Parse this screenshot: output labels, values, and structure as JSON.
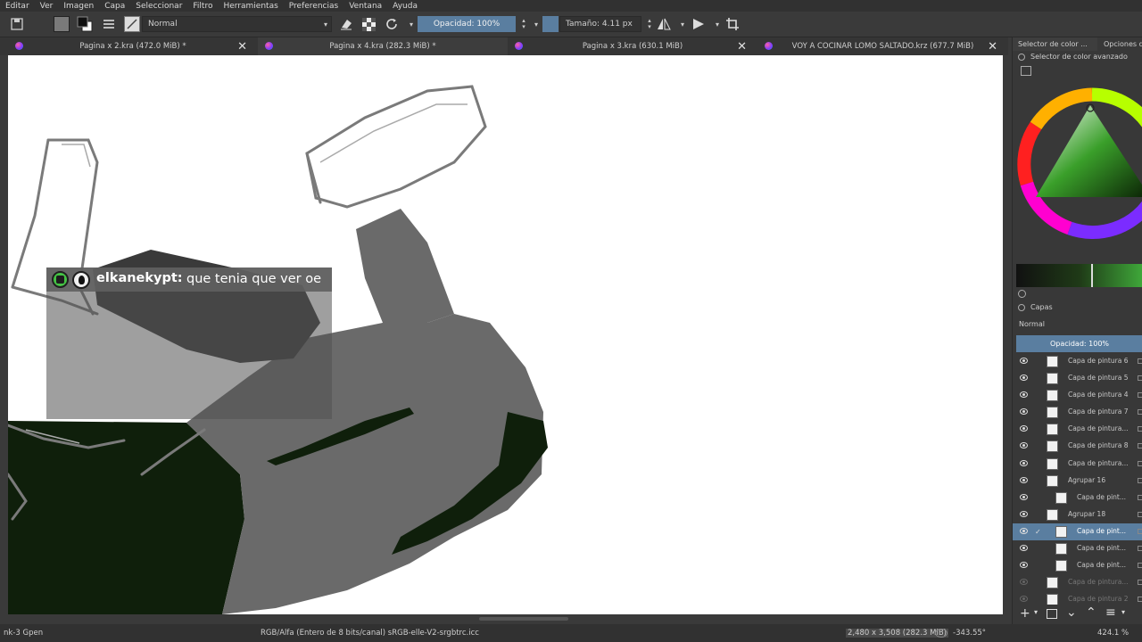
{
  "menu": [
    "Editar",
    "Ver",
    "Imagen",
    "Capa",
    "Seleccionar",
    "Filtro",
    "Herramientas",
    "Preferencias",
    "Ventana",
    "Ayuda"
  ],
  "toolbar": {
    "blend_mode": "Normal",
    "opacity_label": "Opacidad: 100%",
    "size_label": "Tamaño: 4.11 px",
    "icons": [
      "save-icon",
      "color-swatch-icon",
      "swap-colors-icon",
      "brush-presets-icon",
      "brush-preview-icon",
      "eraser-icon",
      "alpha-lock-icon",
      "reload-icon",
      "mirror-horizontal-icon",
      "mirror-vertical-icon",
      "crop-icon"
    ]
  },
  "tabs": [
    {
      "title": "Pagina x 2.kra (472.0 MiB) *"
    },
    {
      "title": "Pagina x 4.kra (282.3 MiB) *"
    },
    {
      "title": "Pagina x 3.kra (630.1 MiB)"
    },
    {
      "title": "VOY A COCINAR LOMO SALTADO.krz (677.7 MiB)"
    }
  ],
  "chat": {
    "username": "elkanekypt:",
    "message": "que tenia que ver oe"
  },
  "docker": {
    "tab_color": "Selector de color ...",
    "tab_options": "Opciones de",
    "color_header": "Selector de color avanzado",
    "layers_header": "Capas",
    "layers_blend": "Normal",
    "layers_opacity": "Opacidad:  100%",
    "layers": [
      {
        "name": "Capa de pintura 6",
        "visible": true,
        "indent": 0,
        "group": false,
        "selected": false,
        "dim": false
      },
      {
        "name": "Capa de pintura 5",
        "visible": true,
        "indent": 0,
        "group": false,
        "selected": false,
        "dim": false
      },
      {
        "name": "Capa de pintura 4",
        "visible": true,
        "indent": 0,
        "group": false,
        "selected": false,
        "dim": false
      },
      {
        "name": "Capa de pintura 7",
        "visible": true,
        "indent": 0,
        "group": false,
        "selected": false,
        "dim": false
      },
      {
        "name": "Capa de pintura...",
        "visible": true,
        "indent": 0,
        "group": false,
        "selected": false,
        "dim": false
      },
      {
        "name": "Capa de pintura 8",
        "visible": true,
        "indent": 0,
        "group": false,
        "selected": false,
        "dim": false
      },
      {
        "name": "Capa de pintura...",
        "visible": true,
        "indent": 0,
        "group": false,
        "selected": false,
        "dim": false
      },
      {
        "name": "Agrupar 16",
        "visible": true,
        "indent": 0,
        "group": true,
        "selected": false,
        "dim": false
      },
      {
        "name": "Capa de pint...",
        "visible": true,
        "indent": 1,
        "group": false,
        "selected": false,
        "dim": false
      },
      {
        "name": "Agrupar 18",
        "visible": true,
        "indent": 0,
        "group": true,
        "selected": false,
        "dim": false
      },
      {
        "name": "Capa de pint...",
        "visible": true,
        "indent": 1,
        "group": false,
        "selected": true,
        "dim": false
      },
      {
        "name": "Capa de pint...",
        "visible": true,
        "indent": 1,
        "group": false,
        "selected": false,
        "dim": false
      },
      {
        "name": "Capa de pint...",
        "visible": true,
        "indent": 1,
        "group": false,
        "selected": false,
        "dim": false
      },
      {
        "name": "Capa de pintura...",
        "visible": false,
        "indent": 0,
        "group": false,
        "selected": false,
        "dim": true
      },
      {
        "name": "Capa de pintura 2",
        "visible": false,
        "indent": 0,
        "group": false,
        "selected": false,
        "dim": true
      }
    ]
  },
  "status": {
    "brush": "nk-3 Gpen",
    "colorspace": "RGB/Alfa (Entero de 8 bits/canal)  sRGB-elle-V2-srgbtrc.icc",
    "dimensions": "2,480 x 3,508 (282.3 MiB)",
    "rotation": "-343.55°",
    "zoom": "424.1 %"
  },
  "colors": {
    "accent": "#5a7ea0",
    "canvas": "#ffffff",
    "dark_green": "#0f1f0b",
    "gray_jacket": "#6a6a6a"
  }
}
